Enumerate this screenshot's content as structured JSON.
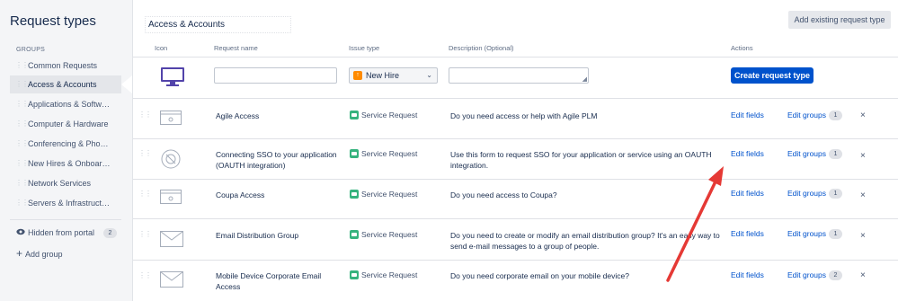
{
  "sidebar": {
    "title": "Request types",
    "groups_label": "GROUPS",
    "items": [
      {
        "label": "Common Requests",
        "active": false
      },
      {
        "label": "Access & Accounts",
        "active": true
      },
      {
        "label": "Applications & Softw…",
        "active": false
      },
      {
        "label": "Computer & Hardware",
        "active": false
      },
      {
        "label": "Conferencing & Pho…",
        "active": false
      },
      {
        "label": "New Hires & Onboar…",
        "active": false
      },
      {
        "label": "Network Services",
        "active": false
      },
      {
        "label": "Servers & Infrastruct…",
        "active": false
      }
    ],
    "hidden_label": "Hidden from portal",
    "hidden_count": "2",
    "add_group_label": "Add group"
  },
  "header": {
    "group_name": "Access & Accounts",
    "add_existing_label": "Add existing request type"
  },
  "table": {
    "columns": {
      "icon": "Icon",
      "name": "Request name",
      "issue_type": "Issue type",
      "description": "Description (Optional)",
      "actions": "Actions"
    },
    "new_row": {
      "name_value": "",
      "issue_type_selected": "New Hire",
      "description_value": "",
      "create_label": "Create request type"
    },
    "rows": [
      {
        "name": "Agile Access",
        "issue_type": "Service Request",
        "description": "Do you need access or help with Agile PLM",
        "edit_fields": "Edit fields",
        "edit_groups": "Edit groups",
        "group_count": "1",
        "icon": "window-icon"
      },
      {
        "name": "Connecting SSO to your application (OAUTH integration)",
        "issue_type": "Service Request",
        "description": "Use this form to request SSO for your application or service using an OAUTH integration.",
        "edit_fields": "Edit fields",
        "edit_groups": "Edit groups",
        "group_count": "1",
        "icon": "sync-icon"
      },
      {
        "name": "Coupa Access",
        "issue_type": "Service Request",
        "description": "Do you need access to Coupa?",
        "edit_fields": "Edit fields",
        "edit_groups": "Edit groups",
        "group_count": "1",
        "icon": "window-icon"
      },
      {
        "name": "Email Distribution Group",
        "issue_type": "Service Request",
        "description": "Do you need to create or modify an email distribution group? It's an easy way to send e-mail messages to a group of people.",
        "edit_fields": "Edit fields",
        "edit_groups": "Edit groups",
        "group_count": "1",
        "icon": "envelope-icon"
      },
      {
        "name": "Mobile Device Corporate Email Access",
        "issue_type": "Service Request",
        "description": "Do you need corporate email on your mobile device?",
        "edit_fields": "Edit fields",
        "edit_groups": "Edit groups",
        "group_count": "2",
        "icon": "envelope-icon"
      }
    ]
  },
  "colors": {
    "accent": "#0052cc",
    "service_request": "#36b37e",
    "new_hire": "#ff8b00",
    "annotation_arrow": "#e53935",
    "computer_icon": "#5243aa"
  }
}
